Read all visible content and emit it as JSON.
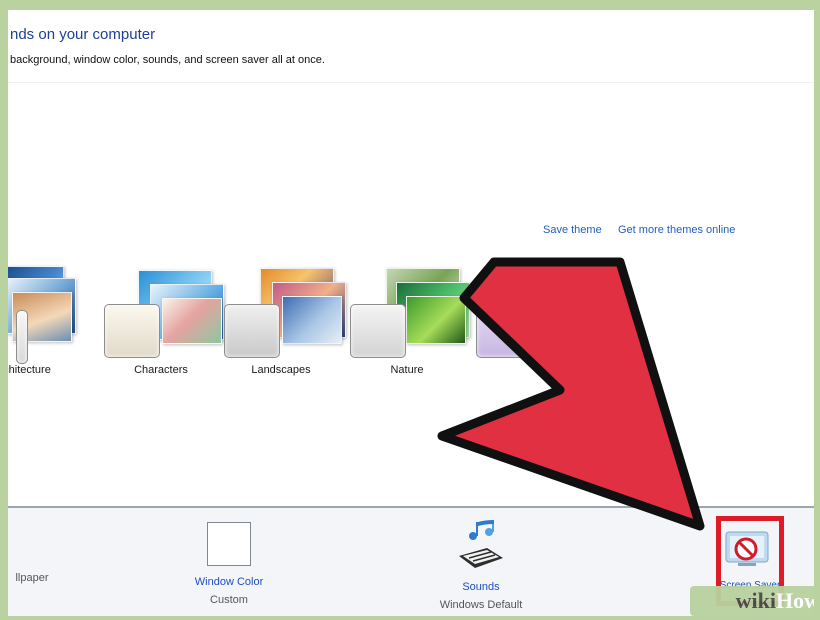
{
  "header": {
    "title": "nds on your computer",
    "subtitle": "background, window color, sounds, and screen saver all at once."
  },
  "links": {
    "save_theme": "Save theme",
    "get_more": "Get more themes online"
  },
  "themes": [
    {
      "label": "chitecture"
    },
    {
      "label": "Characters"
    },
    {
      "label": "Landscapes"
    },
    {
      "label": "Nature"
    },
    {
      "label": ""
    }
  ],
  "bottom": {
    "desktop_background": {
      "label": "",
      "sub": "llpaper"
    },
    "window_color": {
      "label": "Window Color",
      "sub": "Custom"
    },
    "sounds": {
      "label": "Sounds",
      "sub": "Windows Default"
    },
    "screen_saver": {
      "label": "Screen Saver",
      "sub": ""
    }
  },
  "watermark": {
    "part1": "wiki",
    "part2": "How"
  },
  "colors": {
    "frame_border": "#b9d29f",
    "title": "#1e3f93",
    "link": "#1f5fbf",
    "arrow": "#e03042",
    "highlight": "#de1c28"
  }
}
